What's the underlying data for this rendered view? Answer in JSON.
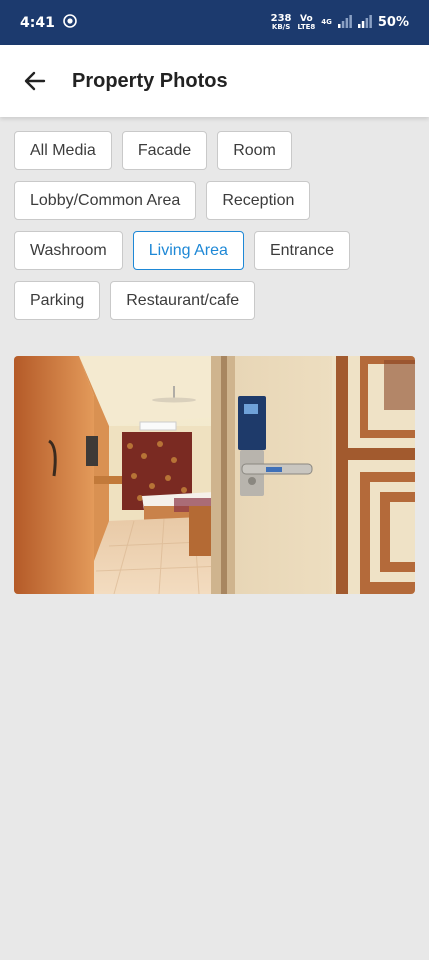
{
  "status_bar": {
    "time": "4:41",
    "net_speed": "238",
    "net_unit": "KB/S",
    "volte": "Vo",
    "lte": "LTE8",
    "network": "4G",
    "battery": "50%"
  },
  "header": {
    "title": "Property Photos",
    "back_icon": "arrow-left-icon"
  },
  "filters": [
    {
      "label": "All Media",
      "active": false
    },
    {
      "label": "Facade",
      "active": false
    },
    {
      "label": "Room",
      "active": false
    },
    {
      "label": "Lobby/Common Area",
      "active": false
    },
    {
      "label": "Reception",
      "active": false
    },
    {
      "label": "Washroom",
      "active": false
    },
    {
      "label": "Living Area",
      "active": true
    },
    {
      "label": "Entrance",
      "active": false
    },
    {
      "label": "Parking",
      "active": false
    },
    {
      "label": "Restaurant/cafe",
      "active": false
    }
  ],
  "colors": {
    "status_bar": "#1c3a6e",
    "accent": "#1e88d6",
    "background": "#e8e8e8"
  }
}
